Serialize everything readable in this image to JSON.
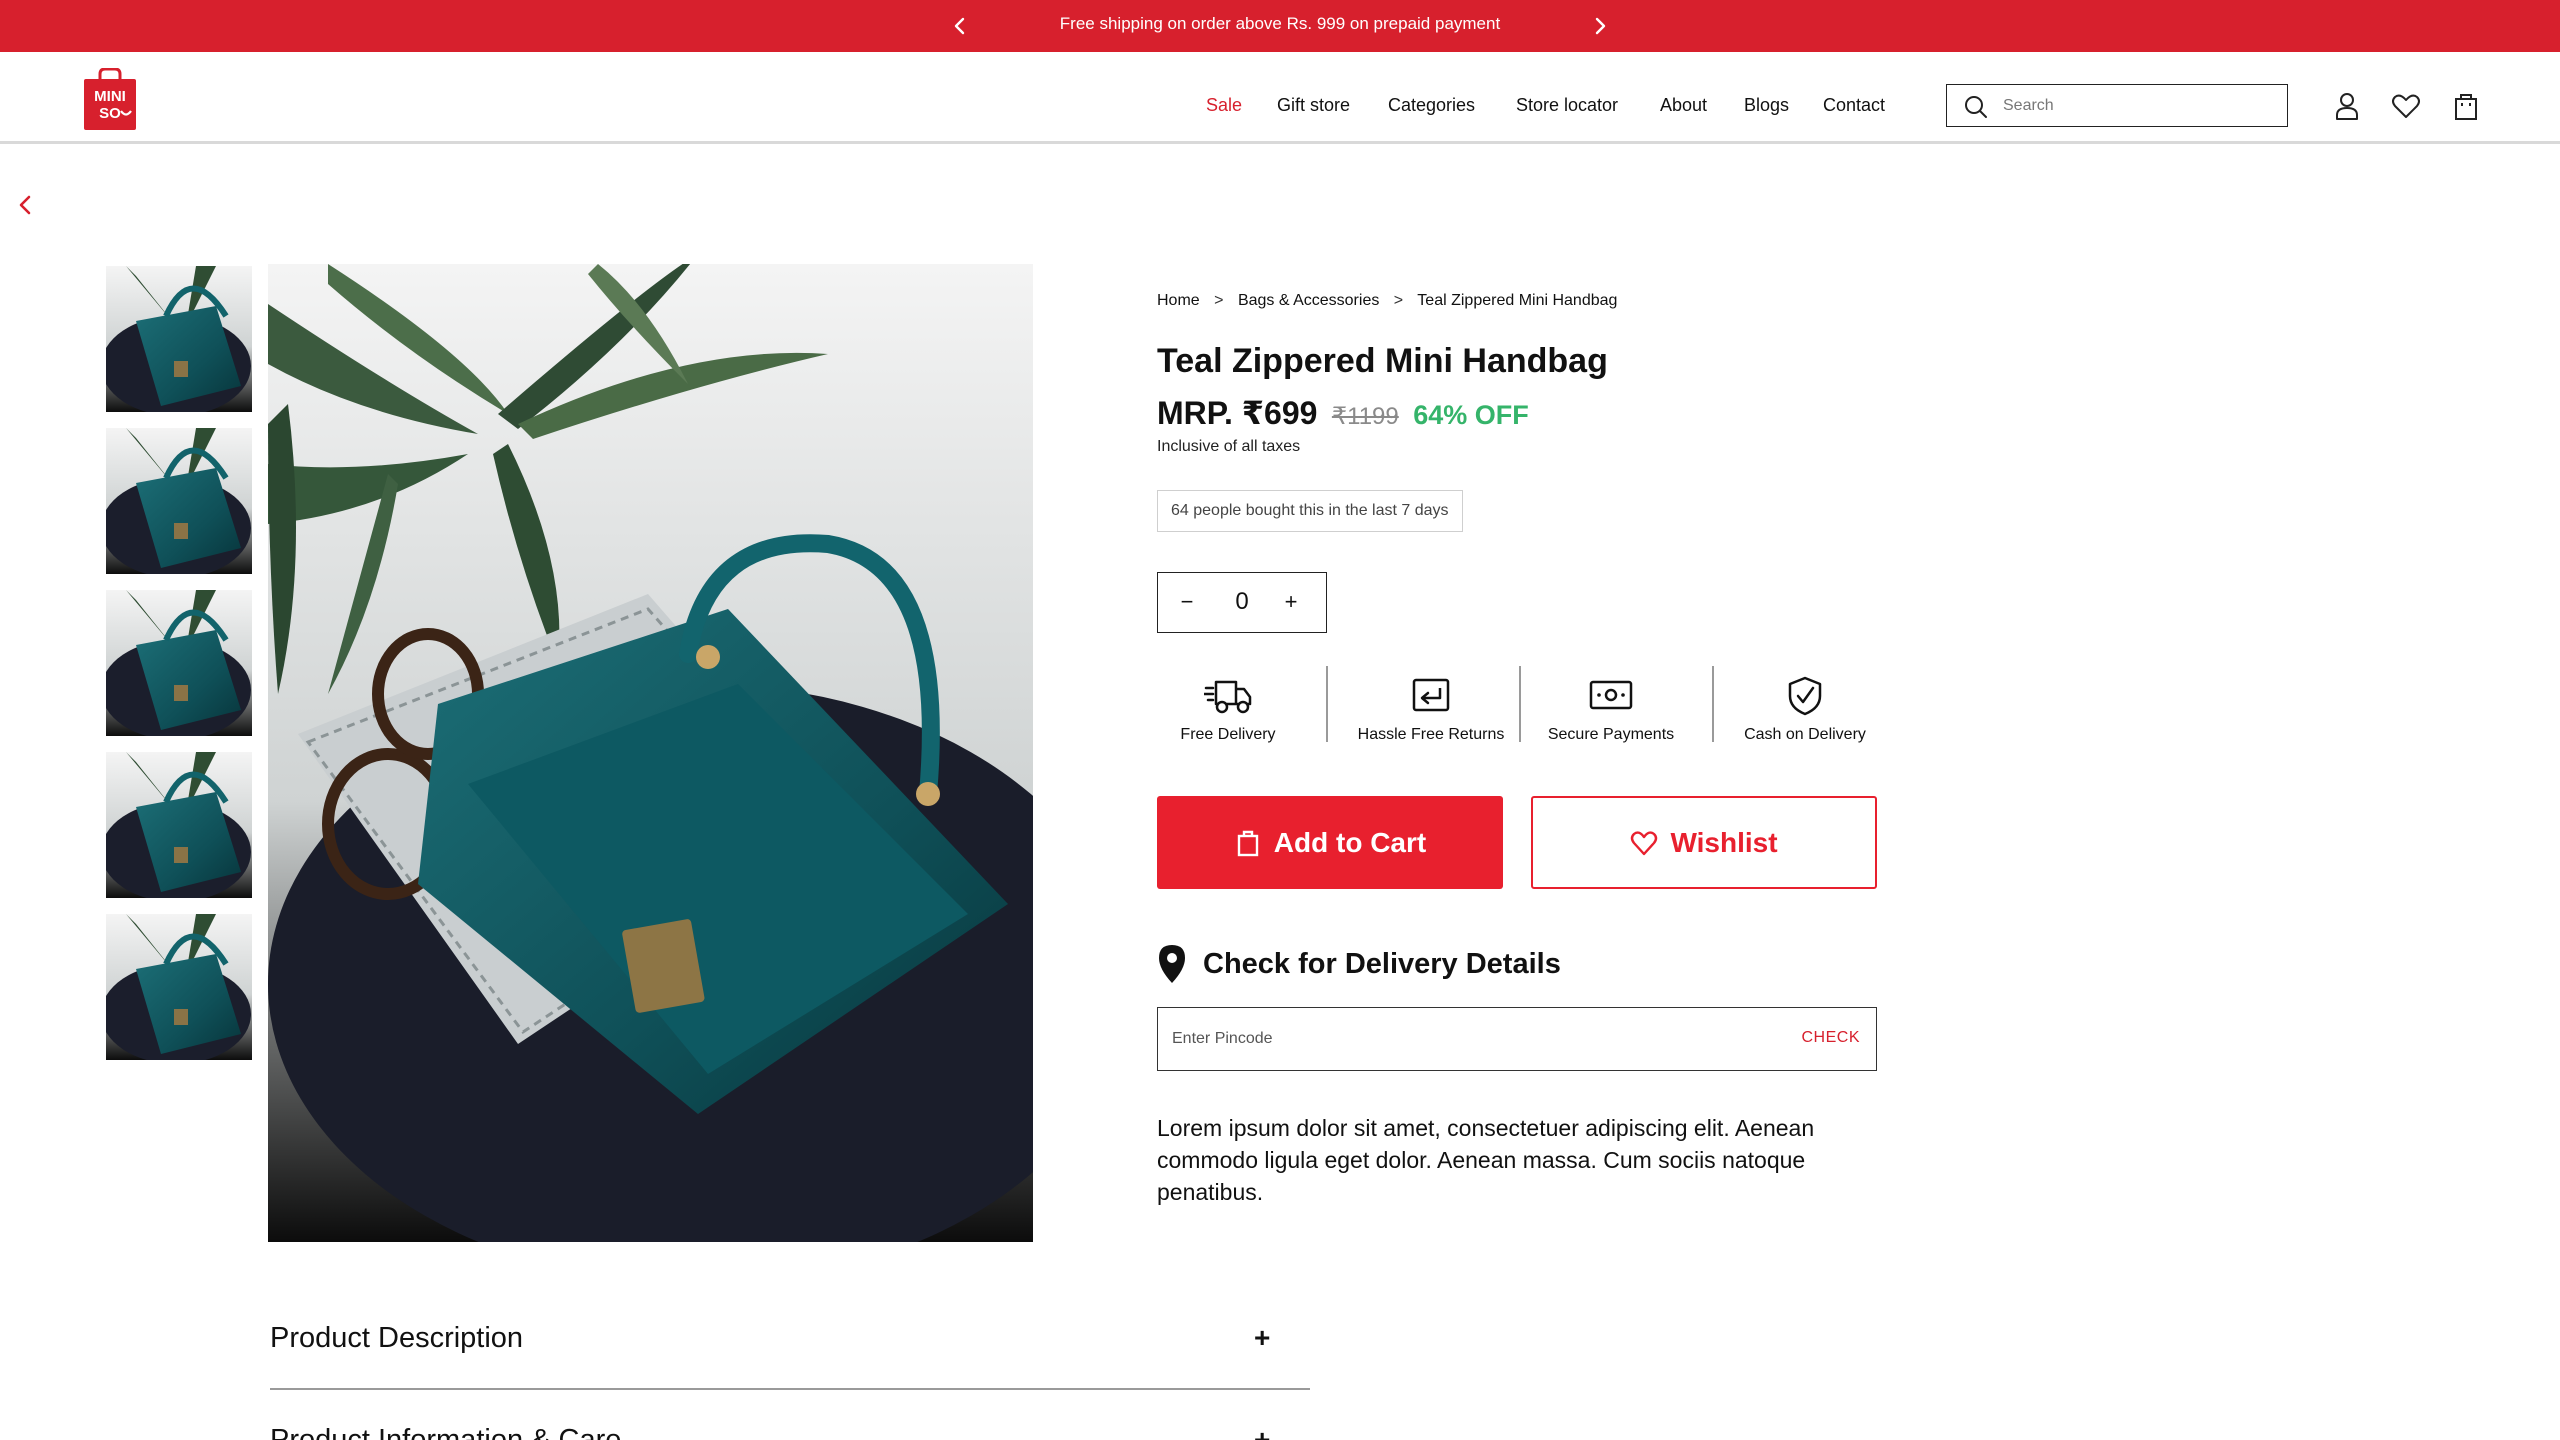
{
  "announcement": {
    "message": "Free shipping on order above Rs. 999 on prepaid payment",
    "prev_icon": "chevron-left-icon",
    "next_icon": "chevron-right-icon"
  },
  "header": {
    "logo": "MINISO",
    "nav": [
      "Sale",
      "Gift store",
      "Categories",
      "Store locator",
      "About",
      "Blogs",
      "Contact"
    ],
    "search_placeholder": "Search",
    "icons": [
      "user-icon",
      "heart-icon",
      "bag-icon"
    ],
    "accent_color": "#d7202d"
  },
  "gallery": {
    "thumbnail_count": 5
  },
  "breadcrumb": [
    "Home",
    ">",
    "Bags & Accessories",
    ">",
    "Teal Zippered Mini Handbag"
  ],
  "product": {
    "title": "Teal Zippered Mini Handbag",
    "price": "MRP. ₹699",
    "old_price": "₹1199",
    "discount": "64% OFF",
    "tax_note": "Inclusive of all taxes",
    "social_proof": "64 people bought this in the last 7 days",
    "quantity": "0",
    "qty_minus": "−",
    "qty_plus": "+"
  },
  "features": [
    {
      "label": "Free Delivery",
      "icon": "delivery-truck-icon"
    },
    {
      "label": "Hassle Free Returns",
      "icon": "return-icon"
    },
    {
      "label": "Secure Payments",
      "icon": "cash-icon"
    },
    {
      "label": "Cash on Delivery",
      "icon": "shield-check-icon"
    }
  ],
  "actions": {
    "add_to_cart": "Add to Cart",
    "wishlist": "Wishlist",
    "cart_color": "#e8202e"
  },
  "delivery": {
    "title": "Check for Delivery Details",
    "pincode_placeholder": "Enter Pincode",
    "check_label": "CHECK"
  },
  "description": "Lorem ipsum dolor sit amet, consectetuer adipiscing elit. Aenean commodo ligula eget dolor. Aenean massa. Cum sociis natoque penatibus.",
  "accordion": [
    {
      "title": "Product Description",
      "icon": "+"
    },
    {
      "title": "Product Information & Care",
      "icon": "+"
    }
  ]
}
